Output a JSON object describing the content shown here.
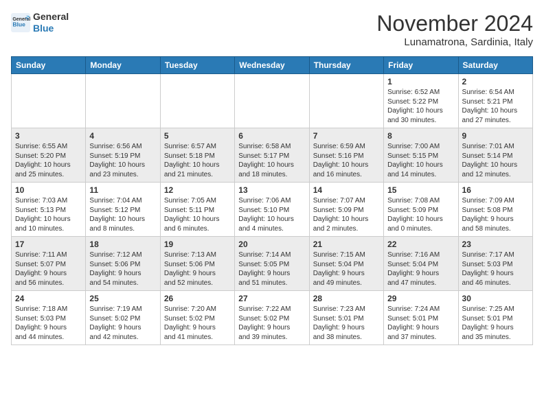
{
  "header": {
    "logo_line1": "General",
    "logo_line2": "Blue",
    "month": "November 2024",
    "location": "Lunamatrona, Sardinia, Italy"
  },
  "weekdays": [
    "Sunday",
    "Monday",
    "Tuesday",
    "Wednesday",
    "Thursday",
    "Friday",
    "Saturday"
  ],
  "weeks": [
    [
      {
        "day": "",
        "info": ""
      },
      {
        "day": "",
        "info": ""
      },
      {
        "day": "",
        "info": ""
      },
      {
        "day": "",
        "info": ""
      },
      {
        "day": "",
        "info": ""
      },
      {
        "day": "1",
        "info": "Sunrise: 6:52 AM\nSunset: 5:22 PM\nDaylight: 10 hours\nand 30 minutes."
      },
      {
        "day": "2",
        "info": "Sunrise: 6:54 AM\nSunset: 5:21 PM\nDaylight: 10 hours\nand 27 minutes."
      }
    ],
    [
      {
        "day": "3",
        "info": "Sunrise: 6:55 AM\nSunset: 5:20 PM\nDaylight: 10 hours\nand 25 minutes."
      },
      {
        "day": "4",
        "info": "Sunrise: 6:56 AM\nSunset: 5:19 PM\nDaylight: 10 hours\nand 23 minutes."
      },
      {
        "day": "5",
        "info": "Sunrise: 6:57 AM\nSunset: 5:18 PM\nDaylight: 10 hours\nand 21 minutes."
      },
      {
        "day": "6",
        "info": "Sunrise: 6:58 AM\nSunset: 5:17 PM\nDaylight: 10 hours\nand 18 minutes."
      },
      {
        "day": "7",
        "info": "Sunrise: 6:59 AM\nSunset: 5:16 PM\nDaylight: 10 hours\nand 16 minutes."
      },
      {
        "day": "8",
        "info": "Sunrise: 7:00 AM\nSunset: 5:15 PM\nDaylight: 10 hours\nand 14 minutes."
      },
      {
        "day": "9",
        "info": "Sunrise: 7:01 AM\nSunset: 5:14 PM\nDaylight: 10 hours\nand 12 minutes."
      }
    ],
    [
      {
        "day": "10",
        "info": "Sunrise: 7:03 AM\nSunset: 5:13 PM\nDaylight: 10 hours\nand 10 minutes."
      },
      {
        "day": "11",
        "info": "Sunrise: 7:04 AM\nSunset: 5:12 PM\nDaylight: 10 hours\nand 8 minutes."
      },
      {
        "day": "12",
        "info": "Sunrise: 7:05 AM\nSunset: 5:11 PM\nDaylight: 10 hours\nand 6 minutes."
      },
      {
        "day": "13",
        "info": "Sunrise: 7:06 AM\nSunset: 5:10 PM\nDaylight: 10 hours\nand 4 minutes."
      },
      {
        "day": "14",
        "info": "Sunrise: 7:07 AM\nSunset: 5:09 PM\nDaylight: 10 hours\nand 2 minutes."
      },
      {
        "day": "15",
        "info": "Sunrise: 7:08 AM\nSunset: 5:09 PM\nDaylight: 10 hours\nand 0 minutes."
      },
      {
        "day": "16",
        "info": "Sunrise: 7:09 AM\nSunset: 5:08 PM\nDaylight: 9 hours\nand 58 minutes."
      }
    ],
    [
      {
        "day": "17",
        "info": "Sunrise: 7:11 AM\nSunset: 5:07 PM\nDaylight: 9 hours\nand 56 minutes."
      },
      {
        "day": "18",
        "info": "Sunrise: 7:12 AM\nSunset: 5:06 PM\nDaylight: 9 hours\nand 54 minutes."
      },
      {
        "day": "19",
        "info": "Sunrise: 7:13 AM\nSunset: 5:06 PM\nDaylight: 9 hours\nand 52 minutes."
      },
      {
        "day": "20",
        "info": "Sunrise: 7:14 AM\nSunset: 5:05 PM\nDaylight: 9 hours\nand 51 minutes."
      },
      {
        "day": "21",
        "info": "Sunrise: 7:15 AM\nSunset: 5:04 PM\nDaylight: 9 hours\nand 49 minutes."
      },
      {
        "day": "22",
        "info": "Sunrise: 7:16 AM\nSunset: 5:04 PM\nDaylight: 9 hours\nand 47 minutes."
      },
      {
        "day": "23",
        "info": "Sunrise: 7:17 AM\nSunset: 5:03 PM\nDaylight: 9 hours\nand 46 minutes."
      }
    ],
    [
      {
        "day": "24",
        "info": "Sunrise: 7:18 AM\nSunset: 5:03 PM\nDaylight: 9 hours\nand 44 minutes."
      },
      {
        "day": "25",
        "info": "Sunrise: 7:19 AM\nSunset: 5:02 PM\nDaylight: 9 hours\nand 42 minutes."
      },
      {
        "day": "26",
        "info": "Sunrise: 7:20 AM\nSunset: 5:02 PM\nDaylight: 9 hours\nand 41 minutes."
      },
      {
        "day": "27",
        "info": "Sunrise: 7:22 AM\nSunset: 5:02 PM\nDaylight: 9 hours\nand 39 minutes."
      },
      {
        "day": "28",
        "info": "Sunrise: 7:23 AM\nSunset: 5:01 PM\nDaylight: 9 hours\nand 38 minutes."
      },
      {
        "day": "29",
        "info": "Sunrise: 7:24 AM\nSunset: 5:01 PM\nDaylight: 9 hours\nand 37 minutes."
      },
      {
        "day": "30",
        "info": "Sunrise: 7:25 AM\nSunset: 5:01 PM\nDaylight: 9 hours\nand 35 minutes."
      }
    ]
  ]
}
